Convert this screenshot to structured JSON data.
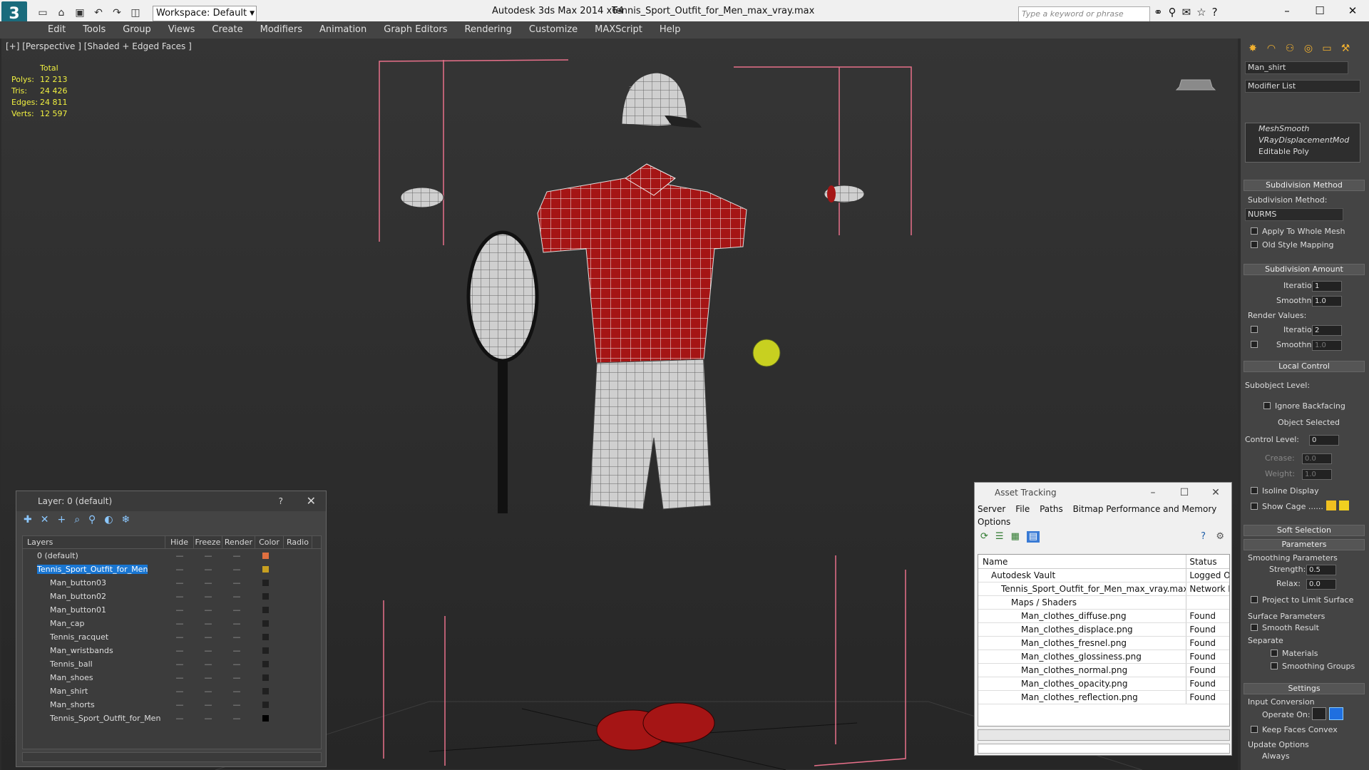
{
  "app": {
    "title": "Autodesk 3ds Max  2014 x64",
    "file": "Tennis_Sport_Outfit_for_Men_max_vray.max",
    "workspace": "Workspace: Default",
    "search_placeholder": "Type a keyword or phrase"
  },
  "menu": [
    "Edit",
    "Tools",
    "Group",
    "Views",
    "Create",
    "Modifiers",
    "Animation",
    "Graph Editors",
    "Rendering",
    "Customize",
    "MAXScript",
    "Help"
  ],
  "viewport": {
    "label": "[+] [Perspective ] [Shaded + Edged Faces ]",
    "stats": {
      "total_label": "Total",
      "rows": [
        {
          "k": "Polys:",
          "v": "12 213"
        },
        {
          "k": "Tris:",
          "v": "24 426"
        },
        {
          "k": "Edges:",
          "v": "24 811"
        },
        {
          "k": "Verts:",
          "v": "12 597"
        }
      ]
    }
  },
  "command_panel": {
    "object_name": "Man_shirt",
    "modifier_list": "Modifier List",
    "stack": [
      "MeshSmooth",
      "VRayDisplacementMod",
      "Editable Poly"
    ],
    "subdivision_method": {
      "title": "Subdivision Method",
      "label": "Subdivision Method:",
      "value": "NURMS",
      "apply_whole": "Apply To Whole Mesh",
      "old_style": "Old Style Mapping"
    },
    "subdivision_amount": {
      "title": "Subdivision Amount",
      "iterations_label": "Iterations:",
      "iterations": "1",
      "smoothness_label": "Smoothness:",
      "smoothness": "1.0",
      "render_values": "Render Values:",
      "r_iterations": "2",
      "r_smoothness": "1.0"
    },
    "local_control": {
      "title": "Local Control",
      "subobject": "Subobject Level:",
      "ignore_backfacing": "Ignore Backfacing",
      "object_selected": "Object Selected",
      "control_level_label": "Control Level:",
      "control_level": "0",
      "crease_label": "Crease:",
      "crease": "0.0",
      "weight_label": "Weight:",
      "weight": "1.0",
      "isoline": "Isoline Display",
      "show_cage": "Show Cage ......"
    },
    "soft_selection": "Soft Selection",
    "parameters": {
      "title": "Parameters",
      "smoothing": "Smoothing Parameters",
      "strength_label": "Strength:",
      "strength": "0.5",
      "relax_label": "Relax:",
      "relax": "0.0",
      "project": "Project to Limit Surface",
      "surface": "Surface Parameters",
      "smooth_result": "Smooth Result",
      "separate": "Separate",
      "materials": "Materials",
      "smoothing_groups": "Smoothing Groups"
    },
    "settings": {
      "title": "Settings",
      "input_conversion": "Input Conversion",
      "operate_on": "Operate On:",
      "keep_convex": "Keep Faces Convex",
      "update_options": "Update Options",
      "always": "Always"
    }
  },
  "layer_window": {
    "title": "Layer: 0 (default)",
    "help": "?",
    "columns": [
      "Layers",
      "Hide",
      "Freeze",
      "Render",
      "Color",
      "Radio"
    ],
    "rows": [
      {
        "name": "0 (default)",
        "color": "#e07040",
        "indent": 1
      },
      {
        "name": "Tennis_Sport_Outfit_for_Men",
        "color": "#c8a020",
        "indent": 1,
        "selected": true
      },
      {
        "name": "Man_button03",
        "color": "#202020",
        "indent": 2
      },
      {
        "name": "Man_button02",
        "color": "#202020",
        "indent": 2
      },
      {
        "name": "Man_button01",
        "color": "#202020",
        "indent": 2
      },
      {
        "name": "Man_cap",
        "color": "#202020",
        "indent": 2
      },
      {
        "name": "Tennis_racquet",
        "color": "#202020",
        "indent": 2
      },
      {
        "name": "Man_wristbands",
        "color": "#202020",
        "indent": 2
      },
      {
        "name": "Tennis_ball",
        "color": "#202020",
        "indent": 2
      },
      {
        "name": "Man_shoes",
        "color": "#202020",
        "indent": 2
      },
      {
        "name": "Man_shirt",
        "color": "#202020",
        "indent": 2
      },
      {
        "name": "Man_shorts",
        "color": "#202020",
        "indent": 2
      },
      {
        "name": "Tennis_Sport_Outfit_for_Men",
        "color": "#000000",
        "indent": 2
      }
    ]
  },
  "asset_window": {
    "title": "Asset Tracking",
    "menu": [
      "Server",
      "File",
      "Paths",
      "Bitmap Performance and Memory",
      "Options"
    ],
    "columns": [
      "Name",
      "Status"
    ],
    "rows": [
      {
        "name": "Autodesk Vault",
        "status": "Logged Out",
        "indent": 1
      },
      {
        "name": "Tennis_Sport_Outfit_for_Men_max_vray.max",
        "status": "Network Path",
        "indent": 2
      },
      {
        "name": "Maps / Shaders",
        "status": "",
        "indent": 3
      },
      {
        "name": "Man_clothes_diffuse.png",
        "status": "Found",
        "indent": 4
      },
      {
        "name": "Man_clothes_displace.png",
        "status": "Found",
        "indent": 4
      },
      {
        "name": "Man_clothes_fresnel.png",
        "status": "Found",
        "indent": 4
      },
      {
        "name": "Man_clothes_glossiness.png",
        "status": "Found",
        "indent": 4
      },
      {
        "name": "Man_clothes_normal.png",
        "status": "Found",
        "indent": 4
      },
      {
        "name": "Man_clothes_opacity.png",
        "status": "Found",
        "indent": 4
      },
      {
        "name": "Man_clothes_reflection.png",
        "status": "Found",
        "indent": 4
      }
    ]
  }
}
